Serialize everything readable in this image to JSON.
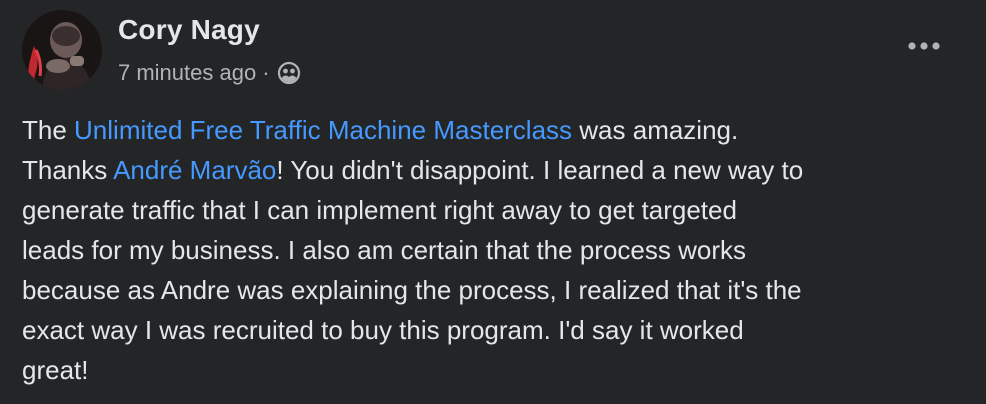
{
  "post": {
    "author": "Cory Nagy",
    "timestamp": "7 minutes ago",
    "separator": "·",
    "audience_icon": "friends-globe-icon",
    "more_icon": "ellipsis-icon",
    "body": {
      "l1_pre": "The ",
      "l1_link": "Unlimited Free Traffic Machine Masterclass",
      "l1_post": " was amazing.",
      "l2_pre": "Thanks ",
      "l2_link": "André Marvão",
      "l2_post": "! You didn't disappoint. I learned a new way to",
      "l3": "generate traffic that I can implement right away to get targeted",
      "l4": "leads for my business. I also am certain that the process works",
      "l5": "because as Andre was explaining the process, I realized that it's the",
      "l6": "exact way I was recruited to buy this program. I'd say it worked",
      "l7": "great!"
    },
    "colors": {
      "background": "#242526",
      "text": "#e4e6eb",
      "secondary_text": "#b0b3b8",
      "link": "#4599ff"
    }
  }
}
